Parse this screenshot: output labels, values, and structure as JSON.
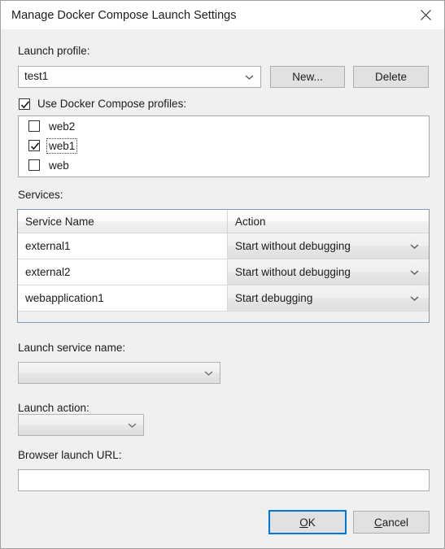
{
  "window": {
    "title": "Manage Docker Compose Launch Settings",
    "close_icon": "close-icon"
  },
  "launch_profile": {
    "label": "Launch profile:",
    "selected": "test1",
    "new_button": {
      "prefix": "New...",
      "label": "New..."
    },
    "delete_button": {
      "label": "Delete"
    }
  },
  "use_profiles": {
    "label": "Use Docker Compose profiles:",
    "checked": true,
    "items": [
      {
        "label": "web2",
        "checked": false,
        "focused": false
      },
      {
        "label": "web1",
        "checked": true,
        "focused": true
      },
      {
        "label": "web",
        "checked": false,
        "focused": false
      }
    ]
  },
  "services": {
    "label": "Services:",
    "columns": [
      "Service Name",
      "Action"
    ],
    "rows": [
      {
        "name": "external1",
        "action": "Start without debugging"
      },
      {
        "name": "external2",
        "action": "Start without debugging"
      },
      {
        "name": "webapplication1",
        "action": "Start debugging"
      }
    ]
  },
  "launch_service_name": {
    "label": "Launch service name:",
    "value": ""
  },
  "launch_action": {
    "label": "Launch action:",
    "value": ""
  },
  "browser_launch_url": {
    "label": "Browser launch URL:",
    "value": "",
    "placeholder": ""
  },
  "footer": {
    "ok": {
      "accel": "O",
      "rest": "K"
    },
    "cancel": {
      "accel": "C",
      "rest": "ancel"
    }
  },
  "colors": {
    "accent": "#0078d7",
    "dialog_background": "#f0f0f0",
    "titlebar_background": "#ffffff",
    "grid_border": "#7a9cbf",
    "button_face": "#e1e1e1"
  }
}
